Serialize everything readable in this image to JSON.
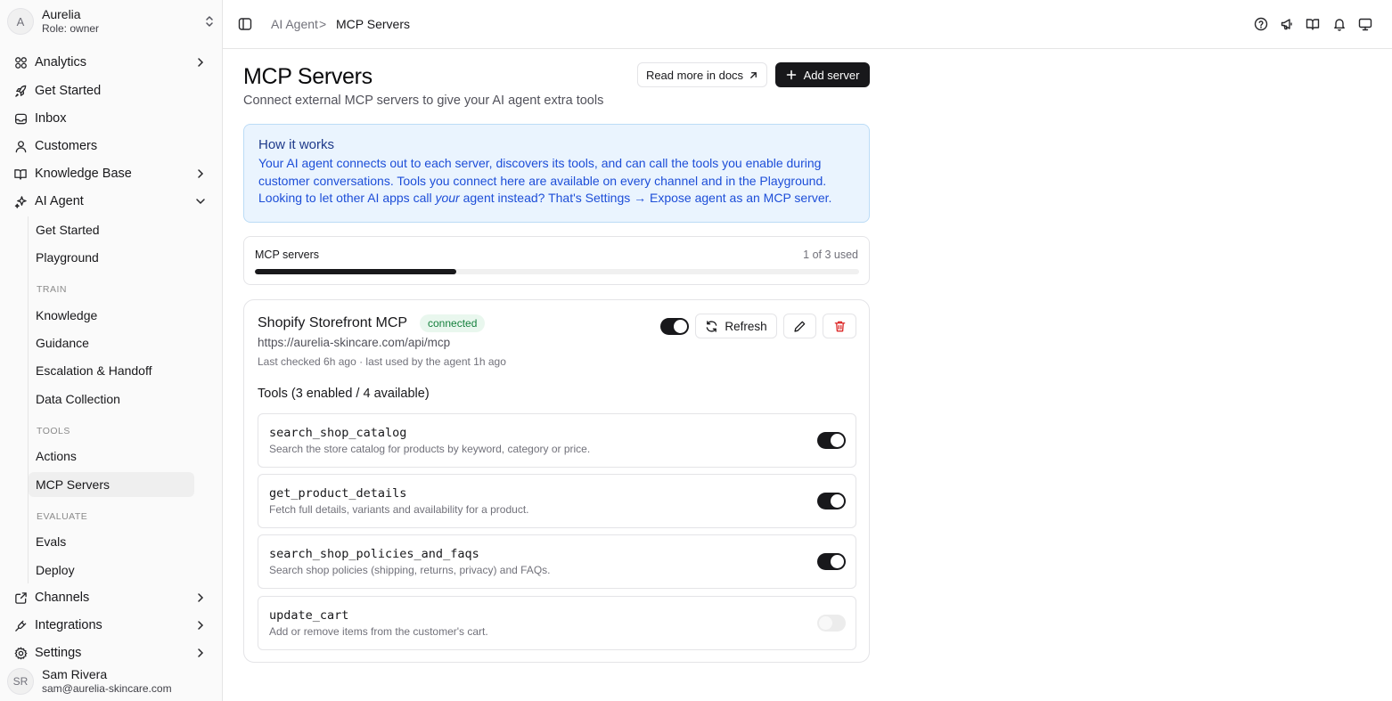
{
  "org": {
    "initial": "A",
    "name": "Aurelia",
    "role": "Role: owner"
  },
  "nav": {
    "analytics": "Analytics",
    "get_started": "Get Started",
    "inbox": "Inbox",
    "customers": "Customers",
    "knowledge_base": "Knowledge Base",
    "ai_agent": "AI Agent",
    "channels": "Channels",
    "integrations": "Integrations",
    "settings": "Settings"
  },
  "ai_agent_sub": {
    "get_started": "Get Started",
    "playground": "Playground",
    "train_label": "TRAIN",
    "knowledge": "Knowledge",
    "guidance": "Guidance",
    "escalation": "Escalation & Handoff",
    "data_collection": "Data Collection",
    "tools_label": "TOOLS",
    "actions": "Actions",
    "mcp_servers": "MCP Servers",
    "evaluate_label": "EVALUATE",
    "evals": "Evals",
    "deploy": "Deploy"
  },
  "user": {
    "initials": "SR",
    "name": "Sam Rivera",
    "email": "sam@aurelia-skincare.com"
  },
  "breadcrumb": {
    "parent": "AI Agent",
    "separator": ">",
    "current": "MCP Servers"
  },
  "page": {
    "title": "MCP Servers",
    "subtitle": "Connect external MCP servers to give your AI agent extra tools",
    "docs_button": "Read more in docs",
    "add_button": "Add server"
  },
  "info": {
    "title": "How it works",
    "line1": "Your AI agent connects out to each server, discovers its tools, and can call the tools you enable during",
    "line2": "customer conversations. Tools you connect here are available on every channel and in the Playground.",
    "line3_pre": "Looking to let other AI apps call ",
    "line3_em": "your",
    "line3_post": " agent instead? That's Settings → Expose agent as an MCP server."
  },
  "usage": {
    "label": "MCP servers",
    "count_text": "1 of 3 used",
    "used": 1,
    "limit": 3
  },
  "server": {
    "name": "Shopify Storefront MCP",
    "status": "connected",
    "url": "https://aurelia-skincare.com/api/mcp",
    "meta": "Last checked 6h ago · last used by the agent 1h ago",
    "enabled": true,
    "refresh_label": "Refresh",
    "tools_heading": "Tools (3 enabled / 4 available)",
    "tools": [
      {
        "name": "search_shop_catalog",
        "description": "Search the store catalog for products by keyword, category or price.",
        "enabled": true
      },
      {
        "name": "get_product_details",
        "description": "Fetch full details, variants and availability for a product.",
        "enabled": true
      },
      {
        "name": "search_shop_policies_and_faqs",
        "description": "Search shop policies (shipping, returns, privacy) and FAQs.",
        "enabled": true
      },
      {
        "name": "update_cart",
        "description": "Add or remove items from the customer's cart.",
        "enabled": false
      }
    ]
  },
  "colors": {
    "accent": "#18181b",
    "info_bg": "#eaf4fe",
    "info_text": "#1d4ed8",
    "badge_bg": "#e9f7ee",
    "badge_text": "#15803d",
    "danger": "#dc2626"
  }
}
